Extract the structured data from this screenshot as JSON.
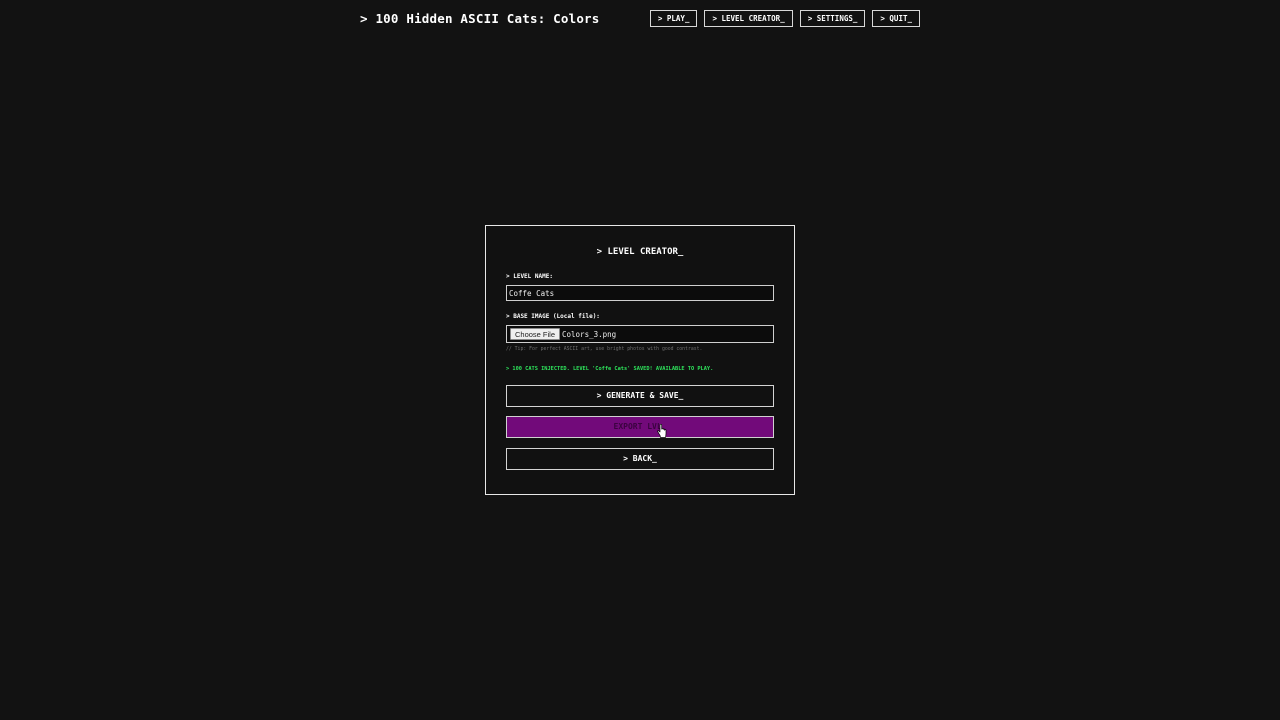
{
  "app": {
    "title": "> 100 Hidden ASCII Cats: Colors"
  },
  "nav": {
    "play": "> PLAY_",
    "level_creator": "> LEVEL CREATOR_",
    "settings": "> SETTINGS_",
    "quit": "> QUIT_"
  },
  "panel": {
    "title": "> LEVEL CREATOR_",
    "level_name_label": "> LEVEL NAME:",
    "level_name_value": "Coffe Cats",
    "base_image_label": "> BASE IMAGE (Local file):",
    "choose_file_label": "Choose File",
    "file_name": "Colors_3.png",
    "tip": "// Tip: For perfect ASCII art, use bright photos with good contrast.",
    "status": "> 100 CATS INJECTED. LEVEL 'Coffe Cats' SAVED! AVAILABLE TO PLAY.",
    "generate_button": "> GENERATE & SAVE_",
    "export_button": "EXPORT LVL_",
    "back_button": "> BACK_"
  },
  "colors": {
    "background": "#121212",
    "foreground": "#ffffff",
    "status_green": "#2ee65c",
    "export_purple": "#720a7a"
  },
  "icons": {
    "cursor": "hand-pointer-icon"
  }
}
